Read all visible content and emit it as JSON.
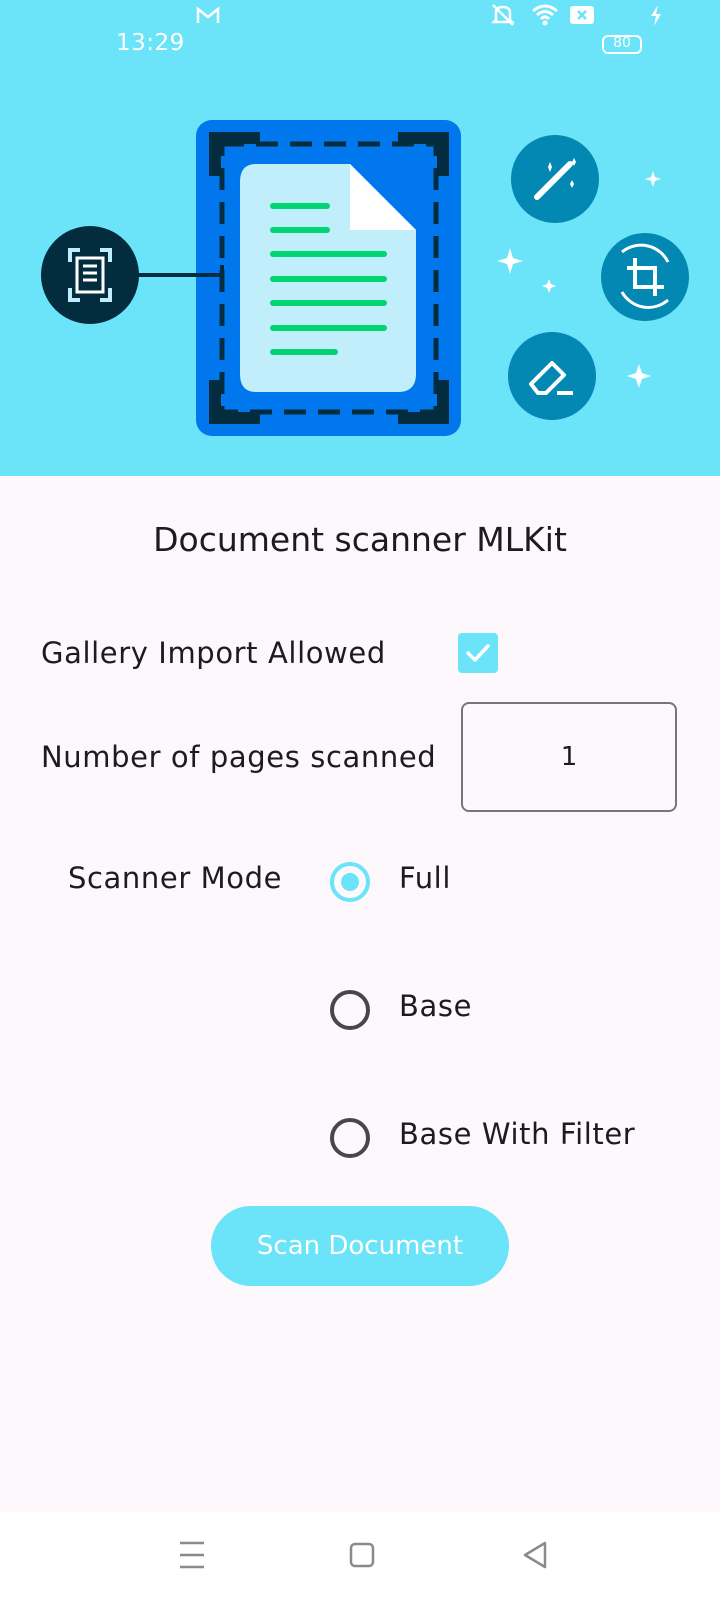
{
  "status_bar": {
    "time": "13:29",
    "battery": "80",
    "icons": [
      "gmail-icon",
      "mute-icon",
      "wifi-icon",
      "sim-off-icon",
      "battery-icon",
      "charging-icon"
    ]
  },
  "hero": {
    "colors": {
      "background": "#6be3f8",
      "document_panel": "#0077ec",
      "page": "#c0eefa",
      "text_lines": "#00d473",
      "dark_circle": "#032d3f",
      "tool_circle": "#0288b3"
    },
    "icons": [
      "scan-icon",
      "document-icon",
      "magic-wand-icon",
      "crop-rotate-icon",
      "eraser-icon",
      "sparkle-icon"
    ]
  },
  "main": {
    "title": "Document scanner MLKit",
    "gallery_import": {
      "label": "Gallery Import Allowed",
      "checked": true
    },
    "pages": {
      "label": "Number of pages scanned",
      "value": "1"
    },
    "scanner_mode": {
      "label": "Scanner Mode",
      "options": [
        {
          "label": "Full",
          "selected": true
        },
        {
          "label": "Base",
          "selected": false
        },
        {
          "label": "Base With Filter",
          "selected": false
        }
      ]
    },
    "scan_button": "Scan Document",
    "accent_color": "#6be3f8"
  },
  "nav_bar": {
    "buttons": [
      "menu-icon",
      "home-icon",
      "back-icon"
    ]
  }
}
